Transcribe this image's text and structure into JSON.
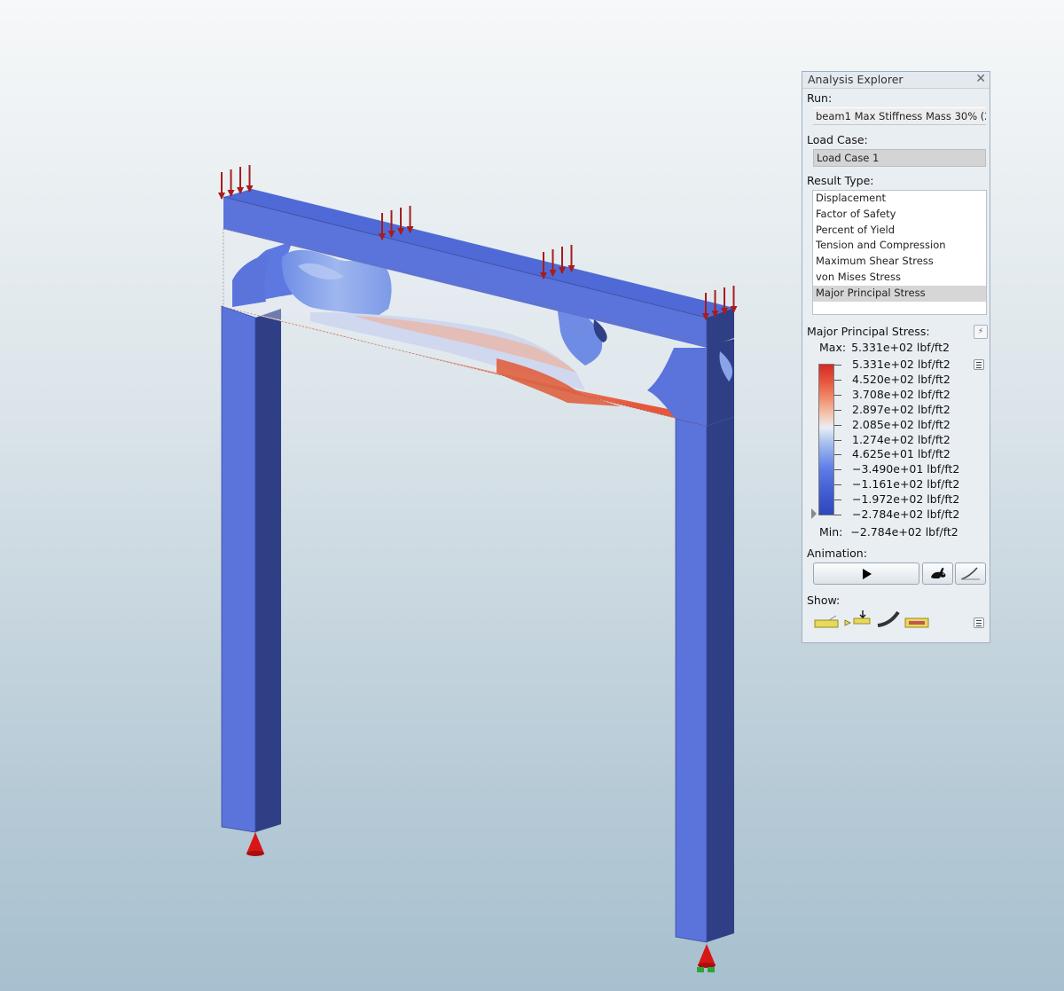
{
  "colors": {
    "beam_blue": "#5a74dc",
    "beam_side": "#2f3f86",
    "load_arrow": "#a81c1c",
    "support_red": "#d91616",
    "support_green": "#2ea53a",
    "stress_max": "#d42a22",
    "stress_min": "#2f47bd"
  },
  "viewport": {
    "loads": [
      "load-arrows",
      "load-arrows",
      "load-arrows",
      "load-arrows"
    ],
    "supports": [
      "support-cone",
      "support-cone"
    ]
  },
  "panel": {
    "title": "Analysis Explorer",
    "close_glyph": "✕",
    "run_label": "Run:",
    "run_value": "beam1 Max Stiffness Mass 30%  (2",
    "load_case_label": "Load Case:",
    "load_case_value": "Load Case 1",
    "result_type_label": "Result Type:",
    "result_types": [
      "Displacement",
      "Factor of Safety",
      "Percent of Yield",
      "Tension and Compression",
      "Maximum Shear Stress",
      "von Mises Stress",
      "Major Principal Stress"
    ],
    "selected_result_type": "Major Principal Stress",
    "legend": {
      "title": "Major Principal Stress:",
      "max_label": "Max:",
      "max_value": "5.331e+02 lbf/ft2",
      "min_label": "Min:",
      "min_value": "−2.784e+02 lbf/ft2",
      "ticks": [
        "5.331e+02 lbf/ft2",
        "4.520e+02 lbf/ft2",
        "3.708e+02 lbf/ft2",
        "2.897e+02 lbf/ft2",
        "2.085e+02 lbf/ft2",
        "1.274e+02 lbf/ft2",
        "4.625e+01 lbf/ft2",
        "−3.490e+01 lbf/ft2",
        "−1.161e+02 lbf/ft2",
        "−1.972e+02 lbf/ft2",
        "−2.784e+02 lbf/ft2"
      ]
    },
    "animation_label": "Animation:",
    "show_label": "Show:",
    "show_icons": [
      "undeformed-model-icon",
      "load-symbols-icon",
      "deformed-shape-icon",
      "element-outline-icon"
    ]
  }
}
